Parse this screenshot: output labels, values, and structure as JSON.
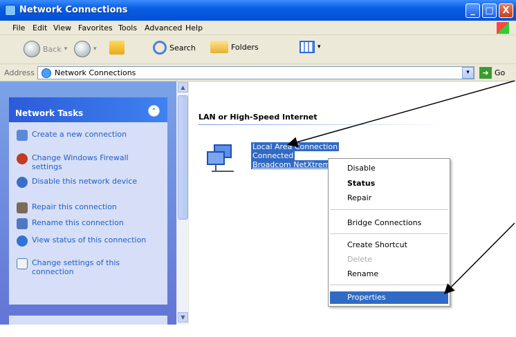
{
  "window": {
    "title": "Network Connections",
    "controls": {
      "minimize": "_",
      "maximize": "□",
      "close": "X"
    }
  },
  "menu": [
    "File",
    "Edit",
    "View",
    "Favorites",
    "Tools",
    "Advanced",
    "Help"
  ],
  "toolbar": {
    "back_label": "Back",
    "search_label": "Search",
    "folders_label": "Folders"
  },
  "address": {
    "label": "Address",
    "value": "Network Connections",
    "go_label": "Go"
  },
  "sidebar": {
    "title": "Network Tasks",
    "items": [
      {
        "label": "Create a new connection",
        "icon": "create-connection-icon"
      },
      {
        "label": "Change Windows Firewall settings",
        "icon": "firewall-icon"
      },
      {
        "label": "Disable this network device",
        "icon": "disable-device-icon"
      },
      {
        "label": "Repair this connection",
        "icon": "repair-icon"
      },
      {
        "label": "Rename this connection",
        "icon": "rename-icon"
      },
      {
        "label": "View status of this connection",
        "icon": "status-icon"
      },
      {
        "label": "Change settings of this connection",
        "icon": "settings-icon"
      }
    ]
  },
  "content": {
    "group_title": "LAN or High-Speed Internet",
    "connection": {
      "name": "Local Area Connection",
      "status": "Connected",
      "device": "Broadcom NetXtrem"
    }
  },
  "context_menu": {
    "items": [
      "Disable",
      "Status",
      "Repair",
      "Bridge Connections",
      "Create Shortcut",
      "Delete",
      "Rename",
      "Properties"
    ],
    "selected": "Properties"
  },
  "colors": {
    "accent": "#316ac5",
    "title_bar": "#0a5ee0",
    "sidebar_bg": "#d6dff7",
    "link": "#215dc6"
  }
}
